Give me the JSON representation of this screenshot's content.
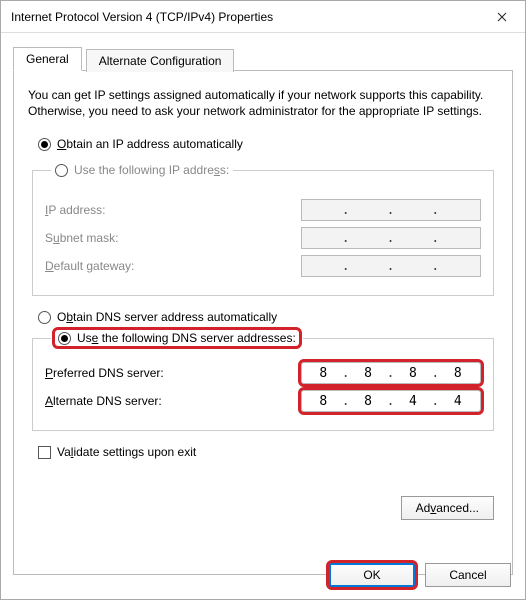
{
  "window": {
    "title": "Internet Protocol Version 4 (TCP/IPv4) Properties"
  },
  "tabs": {
    "general": "General",
    "alternate": "Alternate Configuration"
  },
  "intro": "You can get IP settings assigned automatically if your network supports this capability. Otherwise, you need to ask your network administrator for the appropriate IP settings.",
  "ip": {
    "auto_label_pre": "O",
    "auto_label_post": "btain an IP address automatically",
    "manual_label": "Use the following IP address:",
    "manual_u": "S",
    "ip_address_label_u": "I",
    "ip_address_label": "P address:",
    "subnet_label_pre": "S",
    "subnet_label_u": "u",
    "subnet_label_post": "bnet mask:",
    "gateway_label_u": "D",
    "gateway_label": "efault gateway:"
  },
  "dns": {
    "auto_label_pre": "O",
    "auto_label_u": "b",
    "auto_label_post": "tain DNS server address automatically",
    "manual_label_pre": "Us",
    "manual_label_u": "e",
    "manual_label_post": " the following DNS server addresses:",
    "preferred_label_u": "P",
    "preferred_label": "referred DNS server:",
    "alternate_label_u": "A",
    "alternate_label": "lternate DNS server:",
    "preferred": [
      "8",
      "8",
      "8",
      "8"
    ],
    "alternate": [
      "8",
      "8",
      "4",
      "4"
    ]
  },
  "validate": {
    "label_pre": "Va",
    "label_u": "l",
    "label_post": "idate settings upon exit"
  },
  "buttons": {
    "advanced_label_pre": "Ad",
    "advanced_label_u": "v",
    "advanced_label_post": "anced...",
    "ok": "OK",
    "cancel": "Cancel"
  }
}
